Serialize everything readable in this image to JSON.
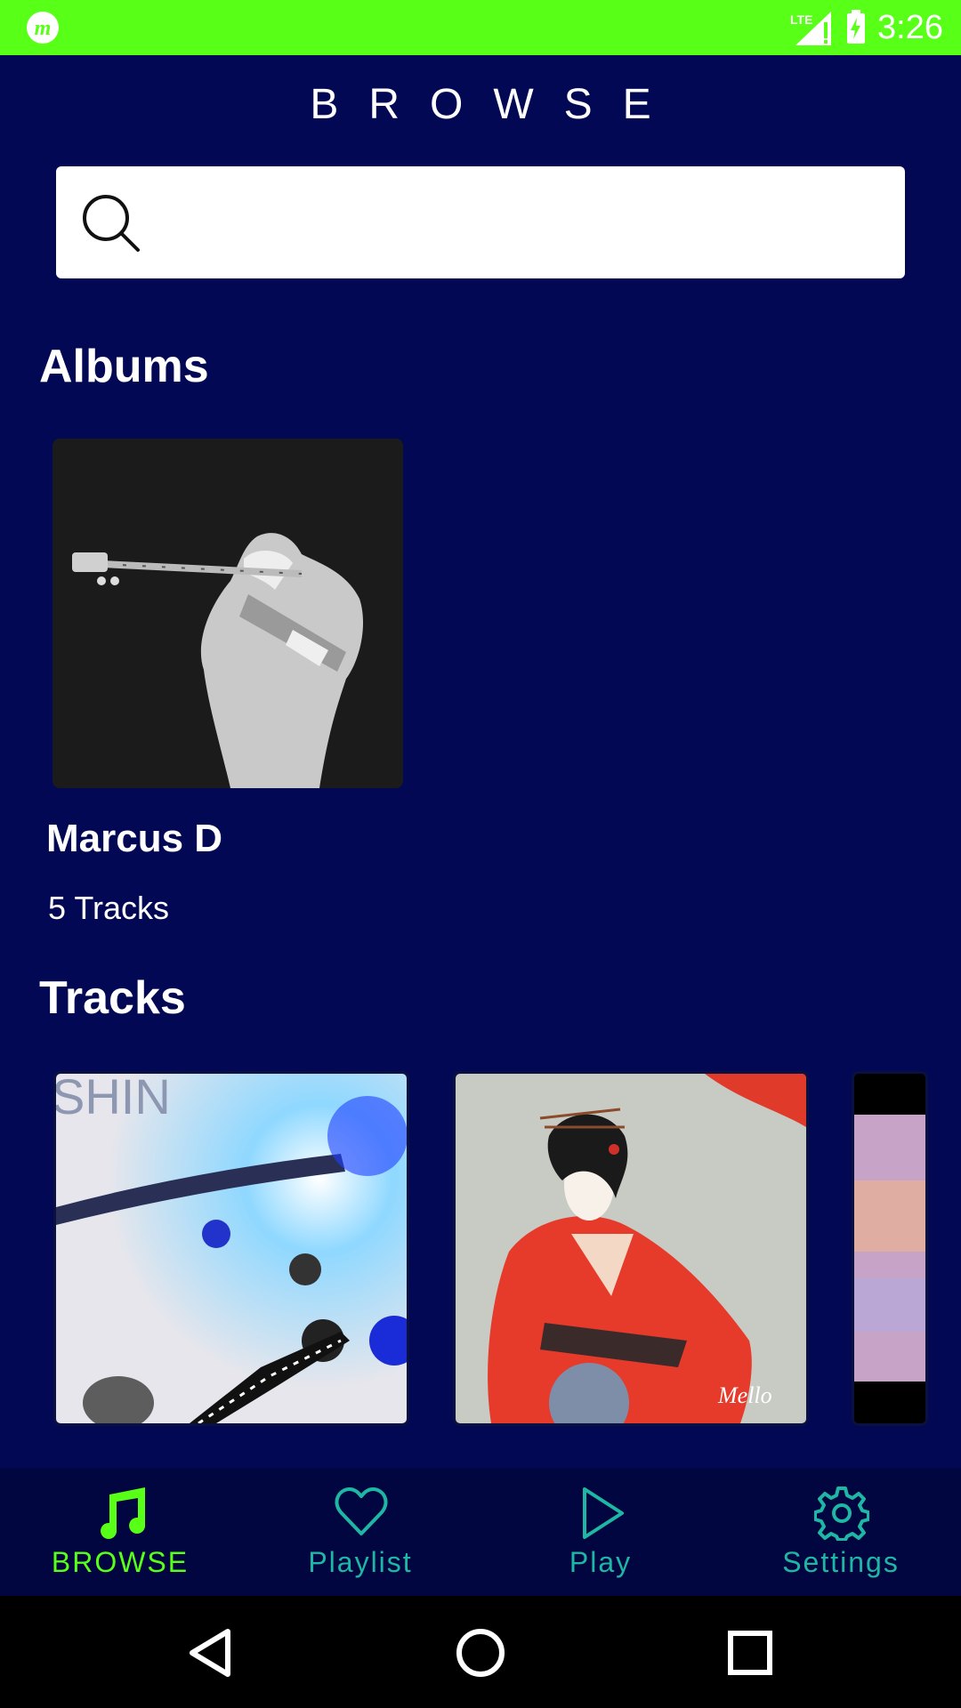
{
  "status_bar": {
    "time": "3:26",
    "network": "LTE",
    "background_color": "#58ff17",
    "icons": [
      "app-logo-icon",
      "signal-icon",
      "battery-charging-icon"
    ]
  },
  "header": {
    "title": "BROWSE"
  },
  "search": {
    "placeholder": "",
    "value": "",
    "icon": "search-icon"
  },
  "albums": {
    "heading": "Albums",
    "items": [
      {
        "name": "Marcus D",
        "track_count": "5 Tracks"
      }
    ]
  },
  "tracks": {
    "heading": "Tracks"
  },
  "bottom_nav": {
    "items": [
      {
        "label": "BROWSE",
        "icon": "music-note-icon",
        "active": true
      },
      {
        "label": "Playlist",
        "icon": "heart-icon",
        "active": false
      },
      {
        "label": "Play",
        "icon": "play-icon",
        "active": false
      },
      {
        "label": "Settings",
        "icon": "gear-icon",
        "active": false
      }
    ],
    "active_color": "#58ff17",
    "inactive_color": "#1eb7a4"
  },
  "system_nav": {
    "buttons": [
      "back-icon",
      "home-icon",
      "recents-icon"
    ]
  },
  "theme": {
    "background": "#020853"
  }
}
